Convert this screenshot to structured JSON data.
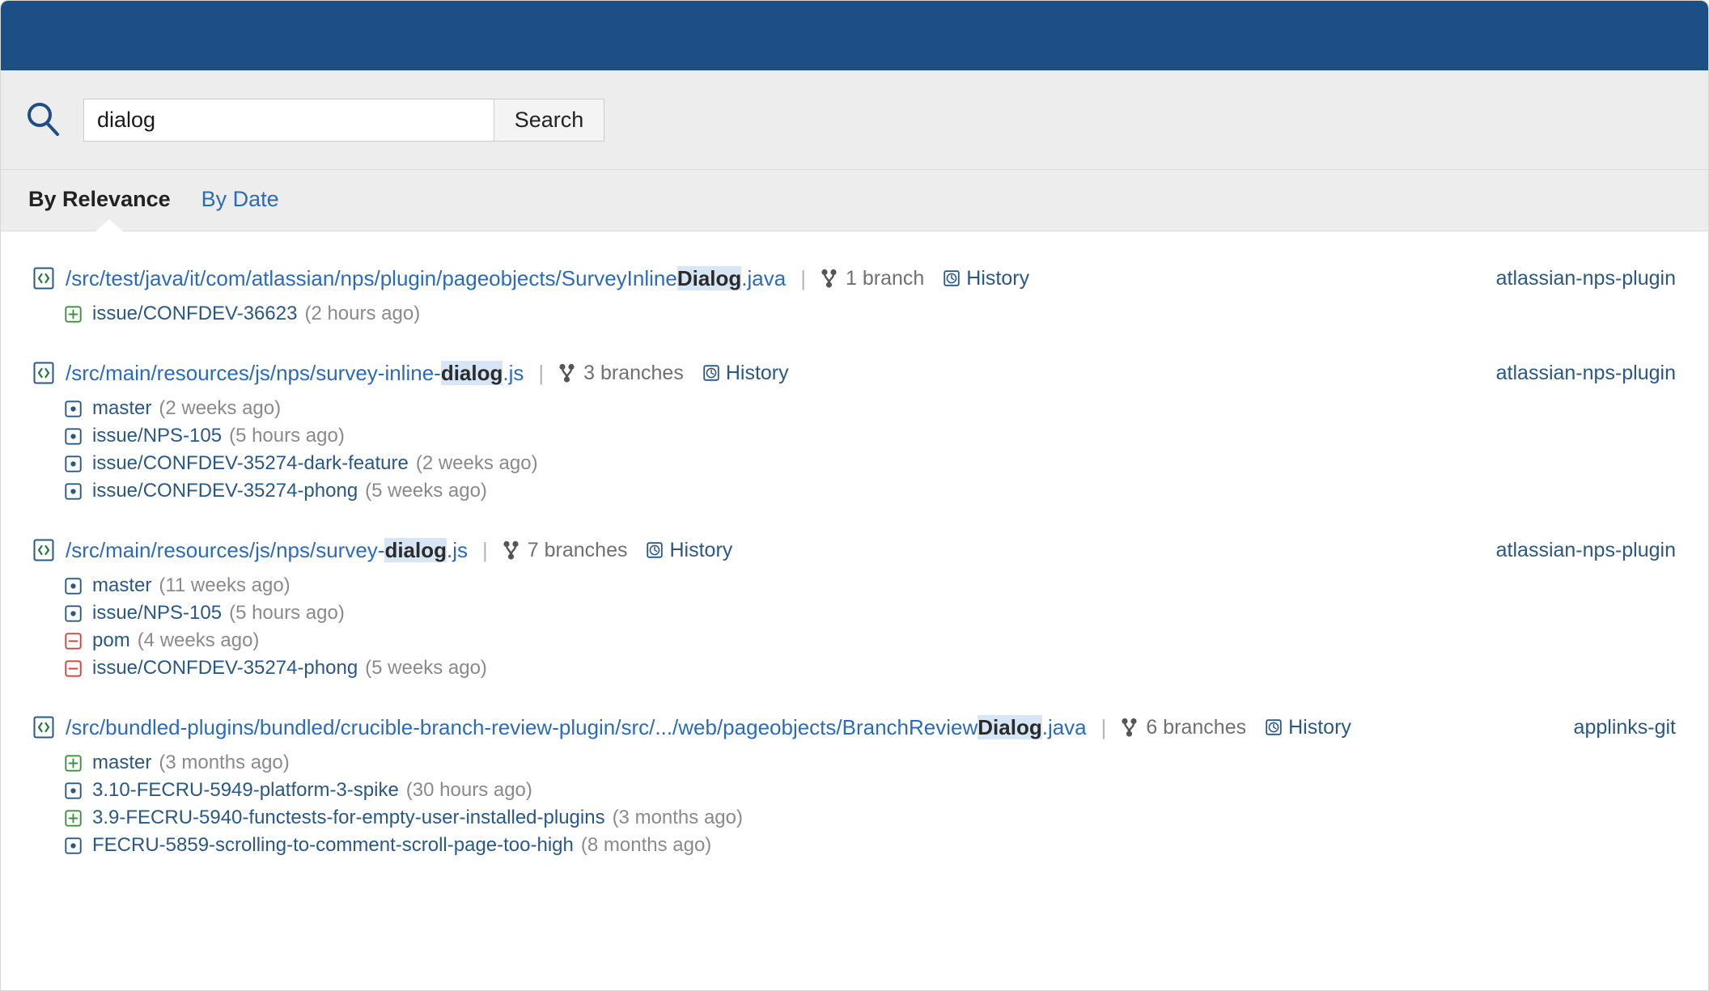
{
  "header": {
    "banner_color": "#1d4e85"
  },
  "search": {
    "magnifier_icon": "search-icon",
    "query": "dialog",
    "placeholder": "",
    "button_label": "Search"
  },
  "tabs": [
    {
      "label": "By Relevance",
      "active": true
    },
    {
      "label": "By Date",
      "active": false
    }
  ],
  "colors": {
    "link": "#2a6bbd",
    "link_dark": "#2a5885",
    "highlight_bg": "#d6e6f7",
    "muted": "#8a8a8a",
    "added": "#3f8f3f",
    "removed": "#d04437",
    "modified": "#2a5885"
  },
  "results": [
    {
      "file_icon": "source-file-icon",
      "path_prefix": "/src/test/java/it/com/atlassian/nps/plugin/pageobjects/SurveyInline",
      "path_match": "Dialog",
      "path_suffix": ".java",
      "branch_icon": "branch-fork-icon",
      "branch_count_label": "1 branch",
      "history_icon": "clock-history-icon",
      "history_label": "History",
      "repository": "atlassian-nps-plugin",
      "branches": [
        {
          "status": "added",
          "icon": "plus-square-icon",
          "name": "issue/CONFDEV-36623",
          "age": "(2 hours ago)"
        }
      ]
    },
    {
      "file_icon": "source-file-icon",
      "path_prefix": "/src/main/resources/js/nps/survey-inline-",
      "path_match": "dialog",
      "path_suffix": ".js",
      "branch_icon": "branch-fork-icon",
      "branch_count_label": "3 branches",
      "history_icon": "clock-history-icon",
      "history_label": "History",
      "repository": "atlassian-nps-plugin",
      "branches": [
        {
          "status": "modified",
          "icon": "dot-square-icon",
          "name": "master",
          "age": "(2 weeks ago)"
        },
        {
          "status": "modified",
          "icon": "dot-square-icon",
          "name": "issue/NPS-105",
          "age": "(5 hours ago)"
        },
        {
          "status": "modified",
          "icon": "dot-square-icon",
          "name": "issue/CONFDEV-35274-dark-feature",
          "age": "(2 weeks ago)"
        },
        {
          "status": "modified",
          "icon": "dot-square-icon",
          "name": "issue/CONFDEV-35274-phong",
          "age": "(5 weeks ago)"
        }
      ]
    },
    {
      "file_icon": "source-file-icon",
      "path_prefix": "/src/main/resources/js/nps/survey-",
      "path_match": "dialog",
      "path_suffix": ".js",
      "branch_icon": "branch-fork-icon",
      "branch_count_label": "7 branches",
      "history_icon": "clock-history-icon",
      "history_label": "History",
      "repository": "atlassian-nps-plugin",
      "branches": [
        {
          "status": "modified",
          "icon": "dot-square-icon",
          "name": "master",
          "age": "(11 weeks ago)"
        },
        {
          "status": "modified",
          "icon": "dot-square-icon",
          "name": "issue/NPS-105",
          "age": "(5 hours ago)"
        },
        {
          "status": "removed",
          "icon": "minus-square-icon",
          "name": "pom",
          "age": "(4 weeks ago)"
        },
        {
          "status": "removed",
          "icon": "minus-square-icon",
          "name": "issue/CONFDEV-35274-phong",
          "age": "(5 weeks ago)"
        }
      ]
    },
    {
      "file_icon": "source-file-icon",
      "path_prefix": "/src/bundled-plugins/bundled/crucible-branch-review-plugin/src/.../web/pageobjects/BranchReview",
      "path_match": "Dialog",
      "path_suffix": ".java",
      "branch_icon": "branch-fork-icon",
      "branch_count_label": "6 branches",
      "history_icon": "clock-history-icon",
      "history_label": "History",
      "repository": "applinks-git",
      "branches": [
        {
          "status": "added",
          "icon": "plus-square-icon",
          "name": "master",
          "age": "(3 months ago)"
        },
        {
          "status": "modified",
          "icon": "dot-square-icon",
          "name": "3.10-FECRU-5949-platform-3-spike",
          "age": "(30 hours ago)"
        },
        {
          "status": "added",
          "icon": "plus-square-icon",
          "name": "3.9-FECRU-5940-functests-for-empty-user-installed-plugins",
          "age": "(3 months ago)"
        },
        {
          "status": "modified",
          "icon": "dot-square-icon",
          "name": "FECRU-5859-scrolling-to-comment-scroll-page-too-high",
          "age": "(8 months ago)"
        }
      ]
    }
  ]
}
